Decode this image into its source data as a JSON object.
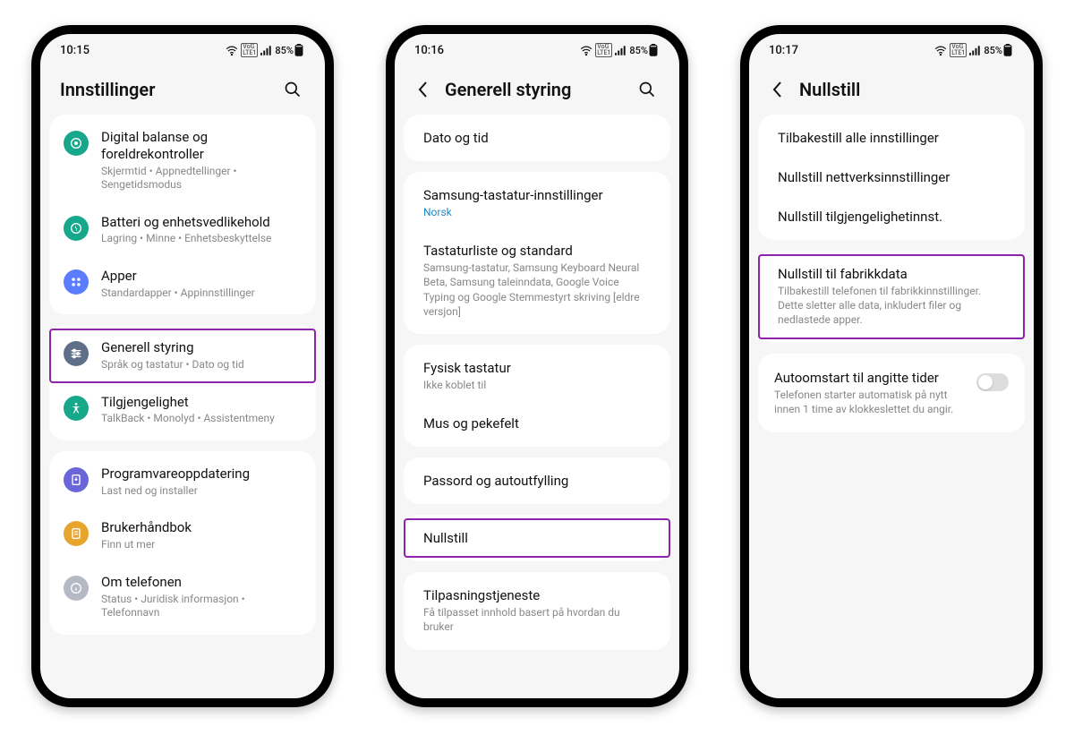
{
  "status": {
    "battery": "85%"
  },
  "phones": [
    {
      "time": "10:15",
      "title": "Innstillinger",
      "hasBack": false,
      "hasSearch": true,
      "groups": [
        {
          "items": [
            {
              "icon": "wellbeing",
              "color": "#17a88b",
              "title": "Digital balanse og foreldrekontroller",
              "sub": "Skjermtid  •  Appnedtellinger  •  Sengetidsmodus",
              "name": "settings-digital-balance"
            },
            {
              "icon": "battery",
              "color": "#17a88b",
              "title": "Batteri og enhetsvedlikehold",
              "sub": "Lagring  •  Minne  •  Enhetsbeskyttelse",
              "name": "settings-battery-care"
            },
            {
              "icon": "apps",
              "color": "#5b7cff",
              "title": "Apper",
              "sub": "Standardapper  •  Appinnstillinger",
              "name": "settings-apps"
            }
          ]
        },
        {
          "items": [
            {
              "icon": "sliders",
              "color": "#5f6f87",
              "title": "Generell styring",
              "sub": "Språk og tastatur  •  Dato og tid",
              "name": "settings-general-management",
              "highlight": true
            },
            {
              "icon": "a11y",
              "color": "#17a88b",
              "title": "Tilgjengelighet",
              "sub": "TalkBack  •  Monolyd  •  Assistentmeny",
              "name": "settings-accessibility"
            }
          ]
        },
        {
          "items": [
            {
              "icon": "update",
              "color": "#6a66d9",
              "title": "Programvareoppdatering",
              "sub": "Last ned og installer",
              "name": "settings-software-update"
            },
            {
              "icon": "manual",
              "color": "#e8a52e",
              "title": "Brukerhåndbok",
              "sub": "Finn ut mer",
              "name": "settings-user-manual"
            },
            {
              "icon": "about",
              "color": "#b5b9c4",
              "title": "Om telefonen",
              "sub": "Status  •  Juridisk informasjon  •  Telefonnavn",
              "name": "settings-about-phone"
            }
          ]
        }
      ]
    },
    {
      "time": "10:16",
      "title": "Generell styring",
      "hasBack": true,
      "hasSearch": true,
      "groups": [
        {
          "items": [
            {
              "title": "Dato og tid",
              "name": "gm-date-time"
            }
          ]
        },
        {
          "items": [
            {
              "title": "Samsung-tastatur-innstillinger",
              "sub": "Norsk",
              "subClass": "link",
              "name": "gm-samsung-keyboard"
            },
            {
              "title": "Tastaturliste og standard",
              "sub": "Samsung-tastatur, Samsung Keyboard Neural Beta, Samsung taleinndata, Google Voice Typing og Google Stemmestyrt skriving [eldre versjon]",
              "name": "gm-keyboard-list"
            }
          ]
        },
        {
          "items": [
            {
              "title": "Fysisk tastatur",
              "sub": "Ikke koblet til",
              "name": "gm-physical-keyboard"
            },
            {
              "title": "Mus og pekefelt",
              "name": "gm-mouse-trackpad"
            }
          ]
        },
        {
          "items": [
            {
              "title": "Passord og autoutfylling",
              "name": "gm-passwords-autofill"
            }
          ]
        },
        {
          "items": [
            {
              "title": "Nullstill",
              "name": "gm-reset",
              "highlight": true
            }
          ]
        },
        {
          "items": [
            {
              "title": "Tilpasningstjeneste",
              "sub": "Få tilpasset innhold basert på hvordan du bruker",
              "name": "gm-customization-service"
            }
          ]
        }
      ]
    },
    {
      "time": "10:17",
      "title": "Nullstill",
      "hasBack": true,
      "hasSearch": false,
      "groups": [
        {
          "items": [
            {
              "title": "Tilbakestill alle innstillinger",
              "name": "reset-all-settings"
            },
            {
              "title": "Nullstill nettverksinnstillinger",
              "name": "reset-network"
            },
            {
              "title": "Nullstill tilgjengelighetinnst.",
              "name": "reset-accessibility"
            }
          ]
        },
        {
          "items": [
            {
              "title": "Nullstill til fabrikkdata",
              "sub": "Tilbakestill telefonen til fabrikkinnstillinger. Dette sletter alle data, inkludert filer og nedlastede apper.",
              "name": "reset-factory-data",
              "highlight": true
            }
          ]
        },
        {
          "toggle": true,
          "items": [
            {
              "title": "Autoomstart til angitte tider",
              "sub": "Telefonen starter automatisk på nytt innen 1 time av klokkeslettet du angir.",
              "name": "reset-auto-restart",
              "toggleOn": false
            }
          ]
        }
      ]
    }
  ]
}
